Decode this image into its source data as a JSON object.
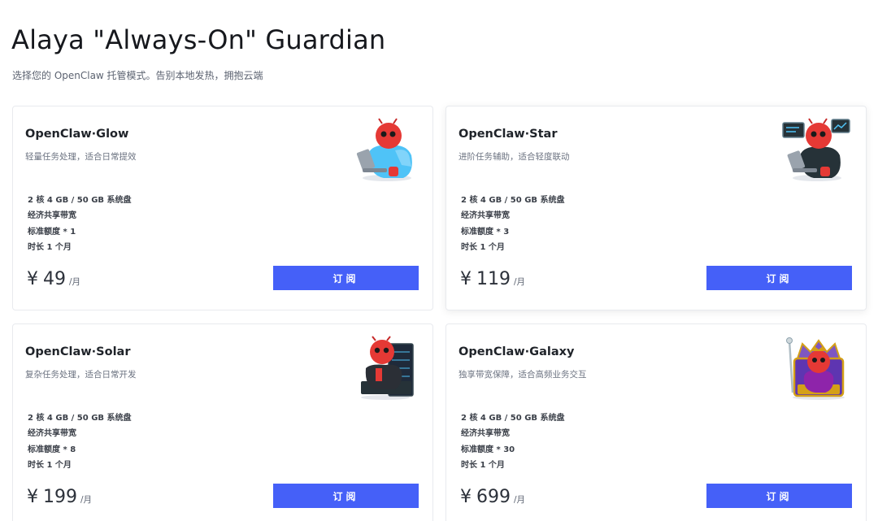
{
  "header": {
    "title": "Alaya \"Always-On\" Guardian",
    "subtitle": "选择您的 OpenClaw 托管模式。告别本地发热，拥抱云端"
  },
  "plans": [
    {
      "name": "OpenClaw·Glow",
      "description": "轻量任务处理，适合日常提效",
      "specs": [
        "2 核 4 GB / 50 GB 系统盘",
        "经济共享带宽",
        "标准额度 * 1",
        "时长 1 个月"
      ],
      "currency": "¥",
      "price": "49",
      "unit": "/月",
      "button_label": "订阅",
      "mascot": "robot-hoodie-laptop-icon"
    },
    {
      "name": "OpenClaw·Star",
      "description": "进阶任务辅助，适合轻度联动",
      "specs": [
        "2 核 4 GB / 50 GB 系统盘",
        "经济共享带宽",
        "标准额度 * 3",
        "时长 1 个月"
      ],
      "currency": "¥",
      "price": "119",
      "unit": "/月",
      "button_label": "订阅",
      "mascot": "robot-monitors-laptop-icon"
    },
    {
      "name": "OpenClaw·Solar",
      "description": "复杂任务处理，适合日常开发",
      "specs": [
        "2 核 4 GB / 50 GB 系统盘",
        "经济共享带宽",
        "标准额度 * 8",
        "时长 1 个月"
      ],
      "currency": "¥",
      "price": "199",
      "unit": "/月",
      "button_label": "订阅",
      "mascot": "robot-server-chair-icon"
    },
    {
      "name": "OpenClaw·Galaxy",
      "description": "独享带宽保障，适合高频业务交互",
      "specs": [
        "2 核 4 GB / 50 GB 系统盘",
        "经济共享带宽",
        "标准额度 * 30",
        "时长 1 个月"
      ],
      "currency": "¥",
      "price": "699",
      "unit": "/月",
      "button_label": "订阅",
      "mascot": "robot-king-throne-icon"
    }
  ],
  "colors": {
    "accent": "#4560f8",
    "card_border": "#e8eaee",
    "robot_red": "#e53935"
  }
}
